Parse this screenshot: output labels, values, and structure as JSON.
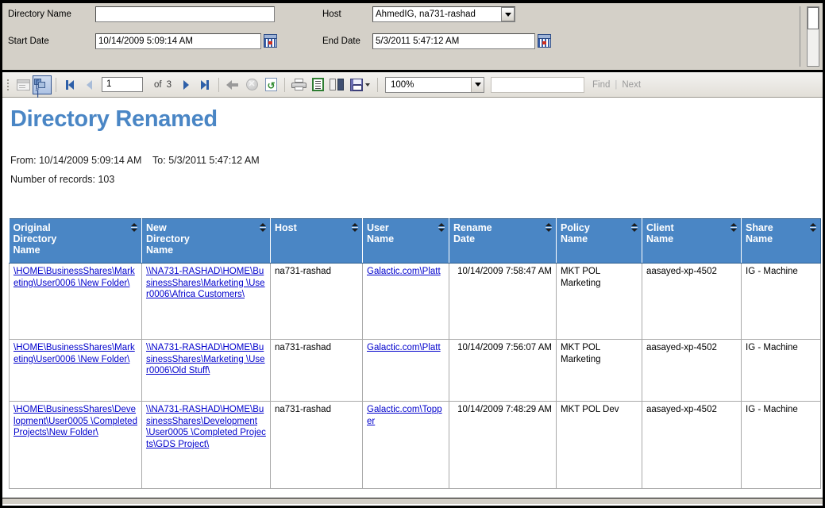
{
  "filters": {
    "directory_name_label": "Directory Name",
    "directory_name_value": "",
    "directory_name_placeholder": "",
    "start_date_label": "Start Date",
    "start_date_value": "10/14/2009 5:09:14 AM",
    "host_label": "Host",
    "host_value": "AhmedIG, na731-rashad",
    "end_date_label": "End Date",
    "end_date_value": "5/3/2011 5:47:12 AM",
    "calendar_icon": "calendar-icon",
    "dropdown_icon": "chevron-down-icon"
  },
  "toolbar": {
    "document_map_icon": "document-map-icon",
    "parameters_icon": "parameters-panel-icon",
    "first_page_icon": "first-page-icon",
    "prev_page_icon": "previous-page-icon",
    "page_number": "1",
    "of_label": "of",
    "page_total": "3",
    "next_page_icon": "next-page-icon",
    "last_page_icon": "last-page-icon",
    "back_icon": "back-icon",
    "stop_icon": "stop-icon",
    "refresh_icon": "refresh-icon",
    "print_icon": "print-icon",
    "page_layout_icon": "page-layout-icon",
    "page_setup_icon": "page-setup-icon",
    "export_icon": "export-save-icon",
    "zoom_value": "100%",
    "find_value": "",
    "find_label": "Find",
    "link_separator": "|",
    "next_label": "Next"
  },
  "report": {
    "title": "Directory Renamed",
    "range_text": "From: 10/14/2009 5:09:14 AM    To: 5/3/2011 5:47:12 AM",
    "records_text": "Number of records: 103",
    "columns": [
      "Original\nDirectory\nName",
      "New\nDirectory\nName",
      "Host",
      "User\nName",
      "Rename\nDate",
      "Policy\nName",
      "Client\nName",
      "Share\nName"
    ],
    "sort_icon": "sort-ascending-descending-icon",
    "rows": [
      {
        "original_directory_name": "\\HOME\\BusinessShares\\Marketing\\User0006 \\New Folder\\",
        "new_directory_name": "\\\\NA731-RASHAD\\HOME\\BusinessShares\\Marketing \\User0006\\Africa Customers\\",
        "host": "na731-rashad",
        "user_name": "Galactic.com\\Platt",
        "rename_date": "10/14/2009 7:58:47 AM",
        "policy_name": "MKT POL Marketing",
        "client_name": "aasayed-xp-4502",
        "share_name": "IG - Machine"
      },
      {
        "original_directory_name": "\\HOME\\BusinessShares\\Marketing\\User0006 \\New Folder\\",
        "new_directory_name": "\\\\NA731-RASHAD\\HOME\\BusinessShares\\Marketing \\User0006\\Old Stuff\\",
        "host": "na731-rashad",
        "user_name": "Galactic.com\\Platt",
        "rename_date": "10/14/2009 7:56:07 AM",
        "policy_name": "MKT POL Marketing",
        "client_name": "aasayed-xp-4502",
        "share_name": "IG - Machine"
      },
      {
        "original_directory_name": "\\HOME\\BusinessShares\\Development\\User0005 \\Completed Projects\\New Folder\\",
        "new_directory_name": "\\\\NA731-RASHAD\\HOME\\BusinessShares\\Development\\User0005 \\Completed Projects\\GDS Project\\",
        "host": "na731-rashad",
        "user_name": "Galactic.com\\Topper",
        "rename_date": "10/14/2009 7:48:29 AM",
        "policy_name": "MKT POL Dev",
        "client_name": "aasayed-xp-4502",
        "share_name": "IG - Machine"
      }
    ]
  },
  "colors": {
    "accent": "#4a86c5",
    "panel": "#d4d0c8",
    "link": "#0000cc",
    "header_text": "#ffffff"
  }
}
